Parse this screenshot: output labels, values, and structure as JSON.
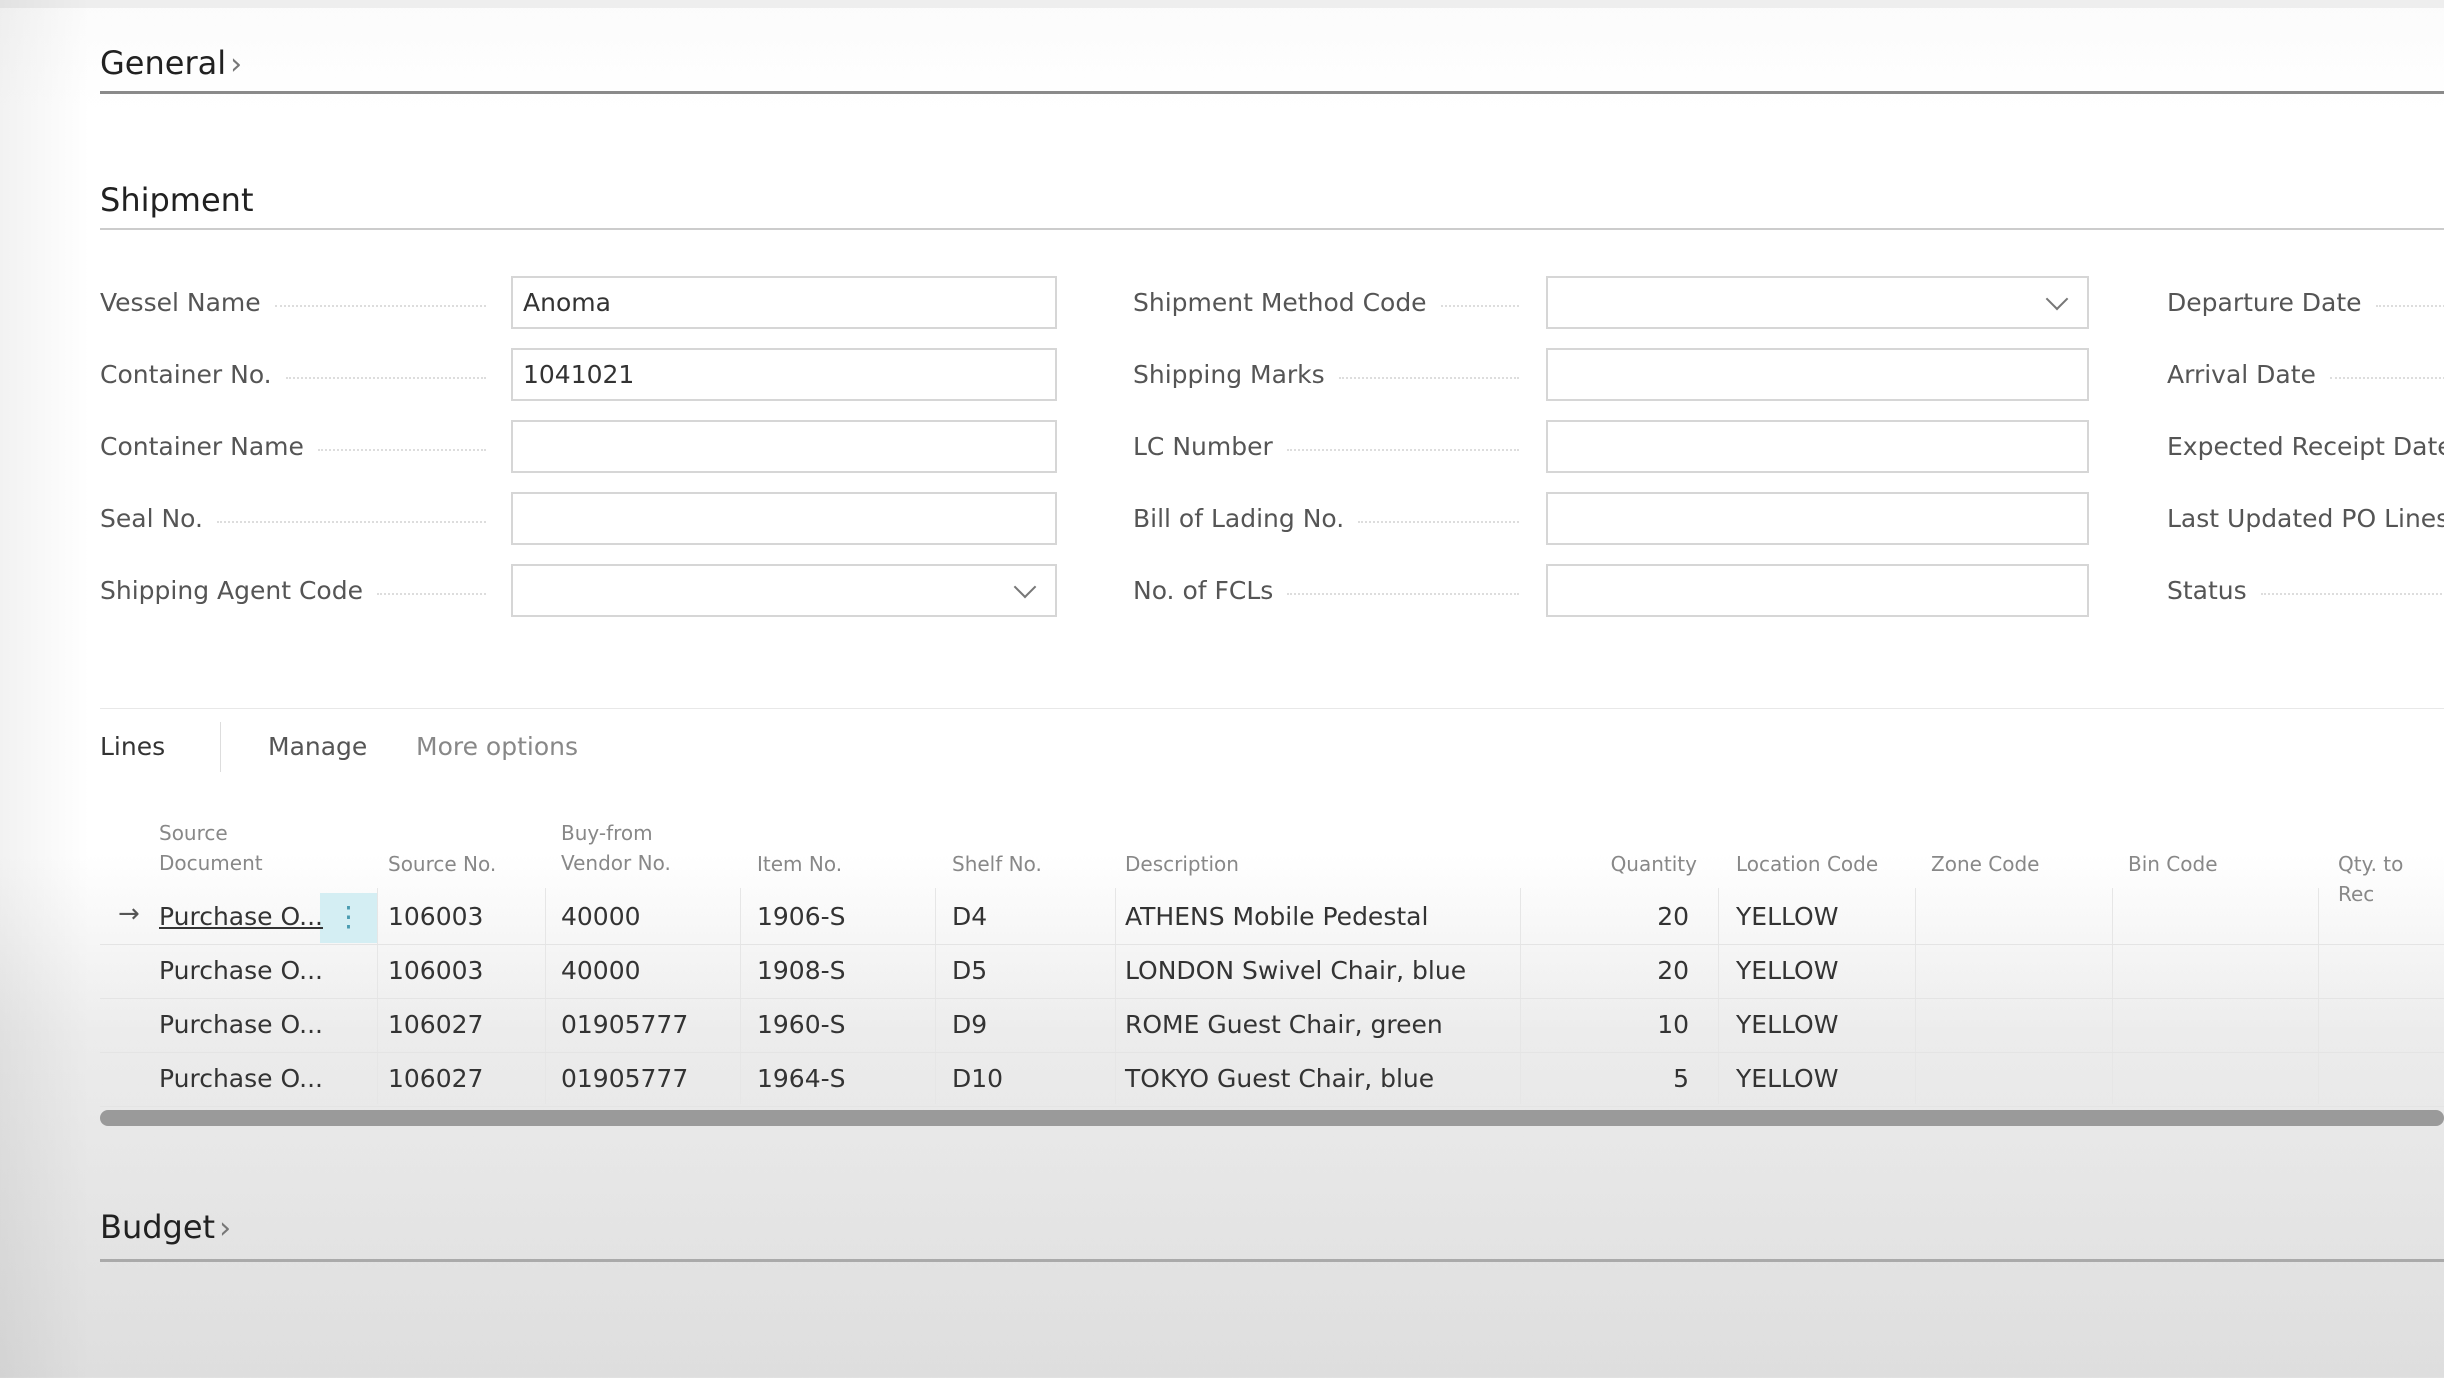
{
  "sections": {
    "general": "General",
    "shipment": "Shipment",
    "budget": "Budget"
  },
  "fields": {
    "col1": [
      {
        "label": "Vessel Name",
        "value": "Anoma",
        "type": "text"
      },
      {
        "label": "Container No.",
        "value": "1041021",
        "type": "text"
      },
      {
        "label": "Container Name",
        "value": "",
        "type": "text"
      },
      {
        "label": "Seal No.",
        "value": "",
        "type": "text"
      },
      {
        "label": "Shipping Agent Code",
        "value": "",
        "type": "dropdown"
      }
    ],
    "col2": [
      {
        "label": "Shipment Method Code",
        "value": "",
        "type": "dropdown"
      },
      {
        "label": "Shipping Marks",
        "value": "",
        "type": "text"
      },
      {
        "label": "LC Number",
        "value": "",
        "type": "text"
      },
      {
        "label": "Bill of Lading No.",
        "value": "",
        "type": "text"
      },
      {
        "label": "No. of FCLs",
        "value": "",
        "type": "text"
      }
    ],
    "col3": [
      {
        "label": "Departure Date"
      },
      {
        "label": "Arrival Date"
      },
      {
        "label": "Expected Receipt Date"
      },
      {
        "label": "Last Updated PO Lines"
      },
      {
        "label": "Status"
      }
    ]
  },
  "lines": {
    "title": "Lines",
    "manage": "Manage",
    "more_options": "More options",
    "columns": [
      "Source Document",
      "Source No.",
      "Buy-from Vendor No.",
      "Item No.",
      "Shelf No.",
      "Description",
      "Quantity",
      "Location Code",
      "Zone Code",
      "Bin Code",
      "Qty. to Rec"
    ],
    "rows": [
      [
        "Purchase O...",
        "106003",
        "40000",
        "1906-S",
        "D4",
        "ATHENS Mobile Pedestal",
        "20",
        "YELLOW"
      ],
      [
        "Purchase O...",
        "106003",
        "40000",
        "1908-S",
        "D5",
        "LONDON Swivel Chair, blue",
        "20",
        "YELLOW"
      ],
      [
        "Purchase O...",
        "106027",
        "01905777",
        "1960-S",
        "D9",
        "ROME Guest Chair, green",
        "10",
        "YELLOW"
      ],
      [
        "Purchase O...",
        "106027",
        "01905777",
        "1964-S",
        "D10",
        "TOKYO Guest Chair, blue",
        "5",
        "YELLOW"
      ]
    ]
  }
}
